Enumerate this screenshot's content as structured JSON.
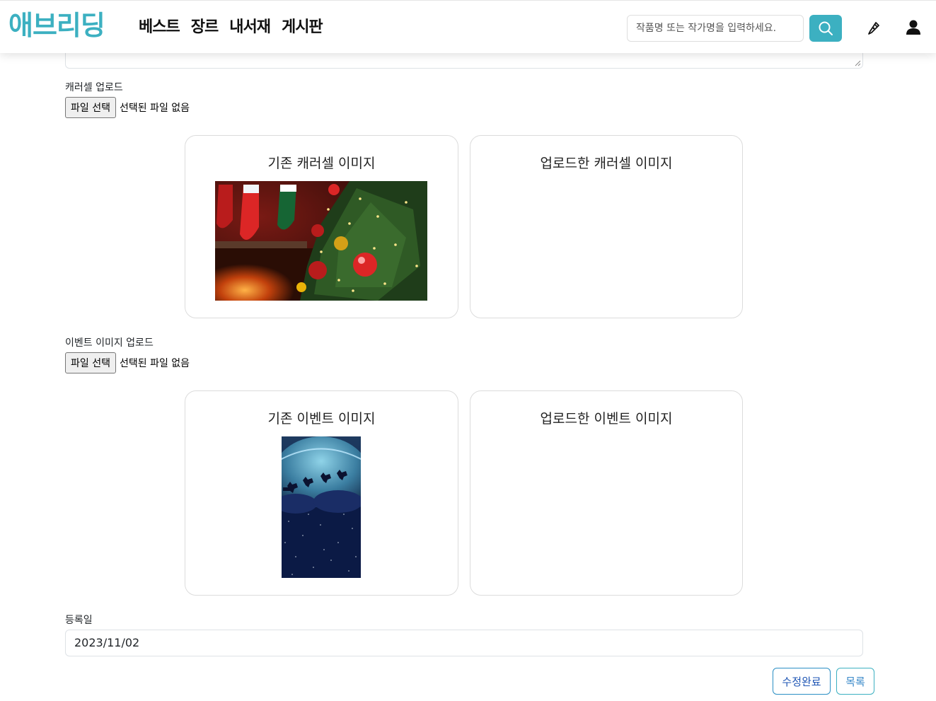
{
  "header": {
    "logo": "애브리딩",
    "nav": [
      "베스트",
      "장르",
      "내서재",
      "게시판"
    ],
    "search_placeholder": "작품명 또는 작가명을 입력하세요.",
    "accent_color": "#3cb0c1"
  },
  "carousel": {
    "label": "캐러셀 업로드",
    "file_button": "파일 선택",
    "file_status": "선택된 파일 없음",
    "existing_title": "기존 캐러셀 이미지",
    "uploaded_title": "업로드한 캐러셀 이미지"
  },
  "event": {
    "label": "이벤트 이미지 업로드",
    "file_button": "파일 선택",
    "file_status": "선택된 파일 없음",
    "existing_title": "기존 이벤트 이미지",
    "uploaded_title": "업로드한 이벤트 이미지"
  },
  "registration": {
    "label": "등록일",
    "value": "2023/11/02"
  },
  "actions": {
    "complete": "수정완료",
    "list": "목록"
  }
}
